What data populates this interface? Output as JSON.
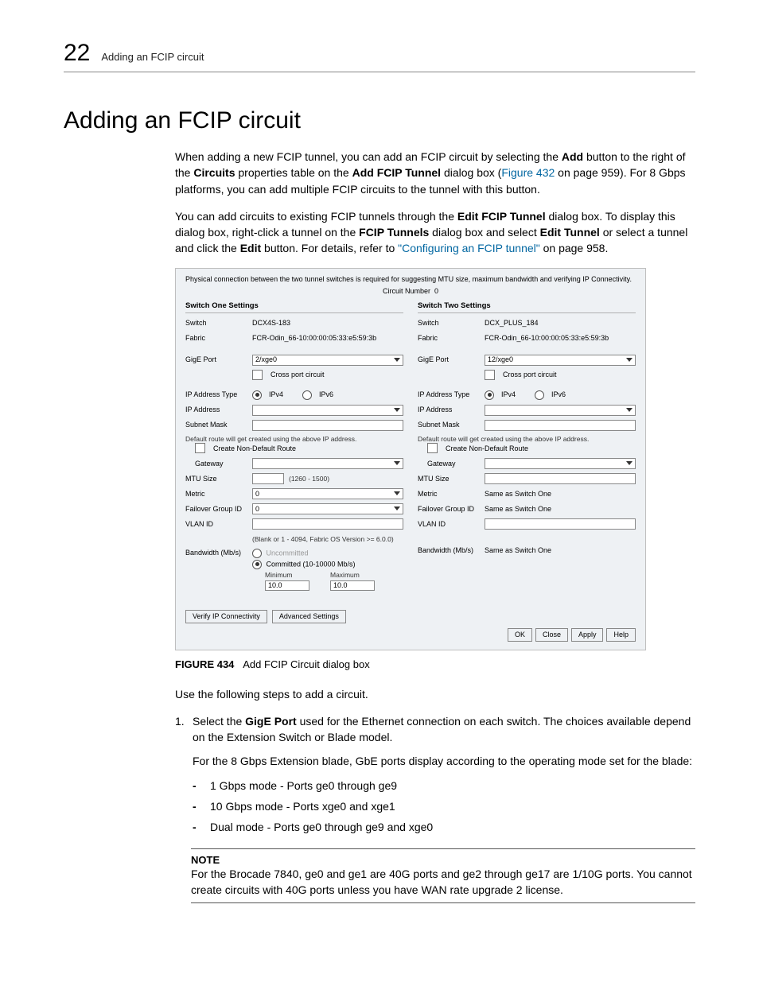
{
  "header": {
    "chapter_number": "22",
    "chapter_text": "Adding an FCIP circuit"
  },
  "title": "Adding an FCIP circuit",
  "para1": {
    "t1": "When adding a new FCIP tunnel, you can add an FCIP circuit by selecting the ",
    "b1": "Add",
    "t2": " button to the right of the ",
    "b2": "Circuits",
    "t3": " properties table on the ",
    "b3": "Add FCIP Tunnel",
    "t4": " dialog box (",
    "link1": "Figure 432",
    "t5": " on page 959). For 8 Gbps platforms, you can add multiple FCIP circuits to the tunnel with this button."
  },
  "para2": {
    "t1": "You can add circuits to existing FCIP tunnels through the ",
    "b1": "Edit FCIP Tunnel",
    "t2": " dialog box. To display this dialog box, right-click a tunnel on the ",
    "b2": "FCIP Tunnels",
    "t3": " dialog box and select ",
    "b3": "Edit Tunnel",
    "t4": " or select a tunnel and click the ",
    "b4": "Edit",
    "t5": " button. For details, refer to ",
    "link1": "\"Configuring an FCIP tunnel\"",
    "t6": " on page 958."
  },
  "dialog": {
    "topnote": "Physical connection between the two tunnel switches is required for suggesting MTU size, maximum bandwidth and verifying IP Connectivity.",
    "circuit_label": "Circuit Number",
    "circuit_value": "0",
    "s1": {
      "title": "Switch One Settings",
      "switch_lbl": "Switch",
      "switch_val": "DCX4S-183",
      "fabric_lbl": "Fabric",
      "fabric_val": "FCR-Odin_66-10:00:00:05:33:e5:59:3b",
      "gige_lbl": "GigE Port",
      "gige_val": "2/xge0",
      "cross_lbl": "Cross port circuit",
      "addrtype_lbl": "IP Address Type",
      "ipv4": "IPv4",
      "ipv6": "IPv6",
      "ipaddr_lbl": "IP Address",
      "subnet_lbl": "Subnet Mask",
      "route_note": "Default route will get created using the above IP address.",
      "create_route_lbl": "Create Non-Default Route",
      "gateway_lbl": "Gateway",
      "mtu_lbl": "MTU Size",
      "mtu_hint": "(1260 - 1500)",
      "metric_lbl": "Metric",
      "metric_val": "0",
      "failover_lbl": "Failover Group ID",
      "failover_val": "0",
      "vlan_lbl": "VLAN ID",
      "vlan_hint": "(Blank or 1 - 4094, Fabric OS Version >= 6.0.0)",
      "bw_lbl": "Bandwidth (Mb/s)",
      "bw_uncommitted": "Uncommitted",
      "bw_committed": "Committed (10-10000 Mb/s)",
      "bw_min_lbl": "Minimum",
      "bw_min_val": "10.0",
      "bw_max_lbl": "Maximum",
      "bw_max_val": "10.0"
    },
    "s2": {
      "title": "Switch Two Settings",
      "switch_lbl": "Switch",
      "switch_val": "DCX_PLUS_184",
      "fabric_lbl": "Fabric",
      "fabric_val": "FCR-Odin_66-10:00:00:05:33:e5:59:3b",
      "gige_lbl": "GigE Port",
      "gige_val": "12/xge0",
      "cross_lbl": "Cross port circuit",
      "addrtype_lbl": "IP Address Type",
      "ipv4": "IPv4",
      "ipv6": "IPv6",
      "ipaddr_lbl": "IP Address",
      "subnet_lbl": "Subnet Mask",
      "route_note": "Default route will get created using the above IP address.",
      "create_route_lbl": "Create Non-Default Route",
      "gateway_lbl": "Gateway",
      "mtu_lbl": "MTU Size",
      "metric_lbl": "Metric",
      "metric_val": "Same as Switch One",
      "failover_lbl": "Failover Group ID",
      "failover_val": "Same as Switch One",
      "vlan_lbl": "VLAN ID",
      "bw_lbl": "Bandwidth (Mb/s)",
      "bw_val": "Same as Switch One"
    },
    "btn_verify": "Verify IP Connectivity",
    "btn_advanced": "Advanced Settings",
    "btn_ok": "OK",
    "btn_close": "Close",
    "btn_apply": "Apply",
    "btn_help": "Help"
  },
  "figcap": {
    "label": "FIGURE 434",
    "text": "Add FCIP Circuit dialog box"
  },
  "para3": "Use the following steps to add a circuit.",
  "step1": {
    "num": "1.",
    "t1": "Select the ",
    "b1": "GigE Port",
    "t2": " used for the Ethernet connection on each switch. The choices available depend on the Extension Switch or Blade model.",
    "sub": "For the 8 Gbps Extension blade, GbE ports display according to the operating mode set for the blade:",
    "li1": "1 Gbps mode - Ports ge0 through ge9",
    "li2": "10 Gbps mode - Ports xge0 and xge1",
    "li3": "Dual mode - Ports ge0 through ge9 and xge0"
  },
  "note": {
    "title": "NOTE",
    "body": "For the Brocade 7840, ge0 and ge1 are 40G ports and ge2 through ge17 are 1/10G ports. You cannot create circuits with 40G ports unless you have WAN rate upgrade 2 license."
  }
}
